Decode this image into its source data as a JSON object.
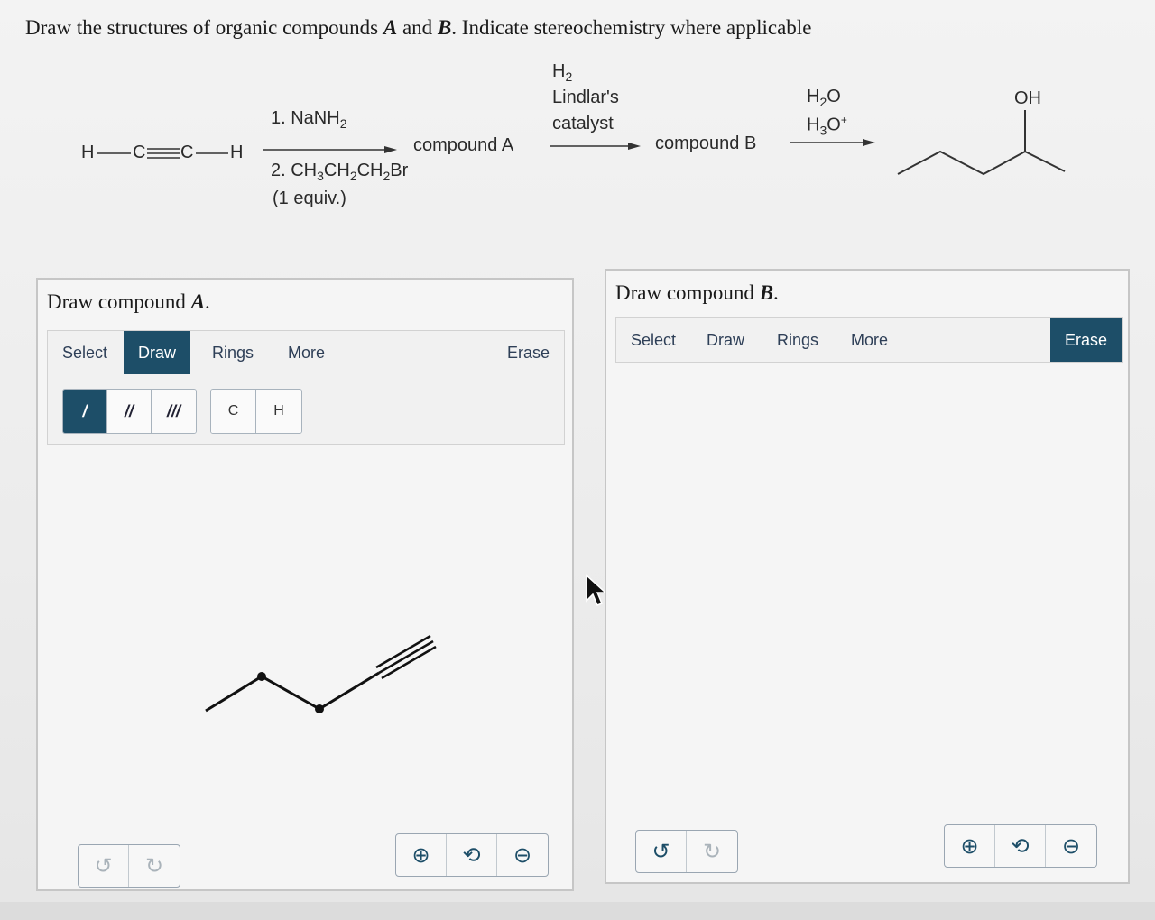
{
  "question": {
    "prefix": "Draw the structures of organic compounds ",
    "a": "A",
    "and": " and ",
    "b": "B",
    "suffix": ". Indicate stereochemistry where applicable"
  },
  "reaction": {
    "start": {
      "h1": "H",
      "c1": "C",
      "c2": "C",
      "h2": "H"
    },
    "step1": {
      "reagent1_prefix": "1. NaNH",
      "reagent1_sub": "2",
      "reagent2_prefix": "2. CH",
      "reagent2_sub1": "3",
      "reagent2_mid1": "CH",
      "reagent2_sub2": "2",
      "reagent2_mid2": "CH",
      "reagent2_sub3": "2",
      "reagent2_end": "Br",
      "equiv": "(1 equiv.)",
      "product": "compound A"
    },
    "step2": {
      "h2_prefix": "H",
      "h2_sub": "2",
      "line2": "Lindlar's",
      "line3": "catalyst",
      "product": "compound B"
    },
    "step3": {
      "water_a": "H",
      "water_sub": "2",
      "water_b": "O",
      "acid_a": "H",
      "acid_sub": "3",
      "acid_b": "O",
      "acid_sup": "+"
    },
    "final_label": "OH"
  },
  "panelA": {
    "title_prefix": "Draw compound ",
    "title_letter": "A",
    "title_suffix": ".",
    "tabs": [
      "Select",
      "Draw",
      "Rings",
      "More"
    ],
    "active_tab": "Draw",
    "erase": "Erase",
    "bond_buttons": [
      "/",
      "//",
      "///"
    ],
    "atom_buttons": [
      "C",
      "H"
    ]
  },
  "panelB": {
    "title_prefix": "Draw compound ",
    "title_letter": "B",
    "title_suffix": ".",
    "tabs": [
      "Select",
      "Draw",
      "Rings",
      "More"
    ],
    "erase": "Erase"
  },
  "colors": {
    "accent": "#1d4e68",
    "tab_text": "#2e3f57"
  }
}
